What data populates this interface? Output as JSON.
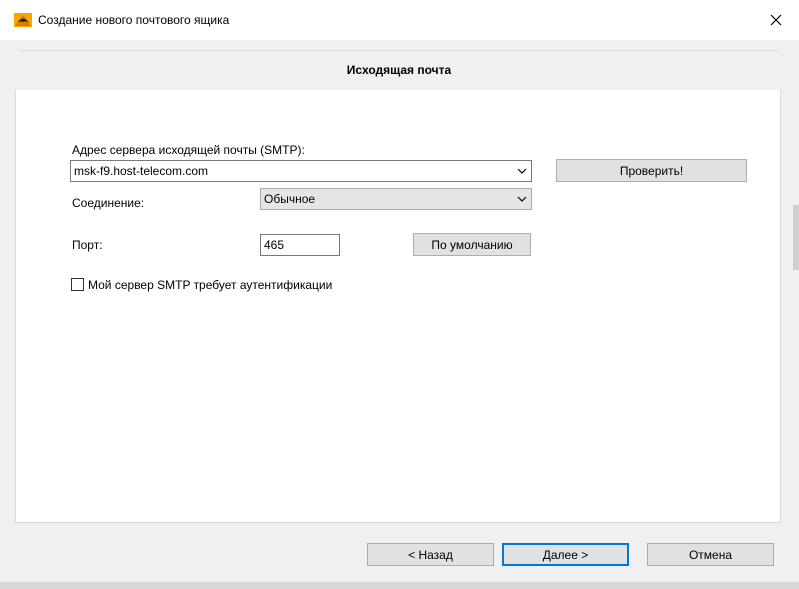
{
  "window": {
    "title": "Создание нового почтового ящика",
    "close_icon": "close-icon",
    "app_icon": "bat-mail-icon"
  },
  "header": {
    "title": "Исходящая почта"
  },
  "form": {
    "smtp_label": "Адрес сервера исходящей почты (SMTP):",
    "smtp_value": "msk-f9.host-telecom.com",
    "check_button": "Проверить!",
    "connection_label": "Соединение:",
    "connection_value": "Обычное",
    "port_label": "Порт:",
    "port_value": "465",
    "default_button": "По умолчанию",
    "auth_checkbox_label": "Мой сервер SMTP требует аутентификации",
    "auth_checked": false
  },
  "footer": {
    "back_button": "<  Назад",
    "next_button": "Далее  >",
    "cancel_button": "Отмена"
  },
  "colors": {
    "accent": "#0078d7",
    "button_bg": "#e1e1e1",
    "panel_bg": "#ffffff",
    "window_bg": "#f0f0f0"
  }
}
